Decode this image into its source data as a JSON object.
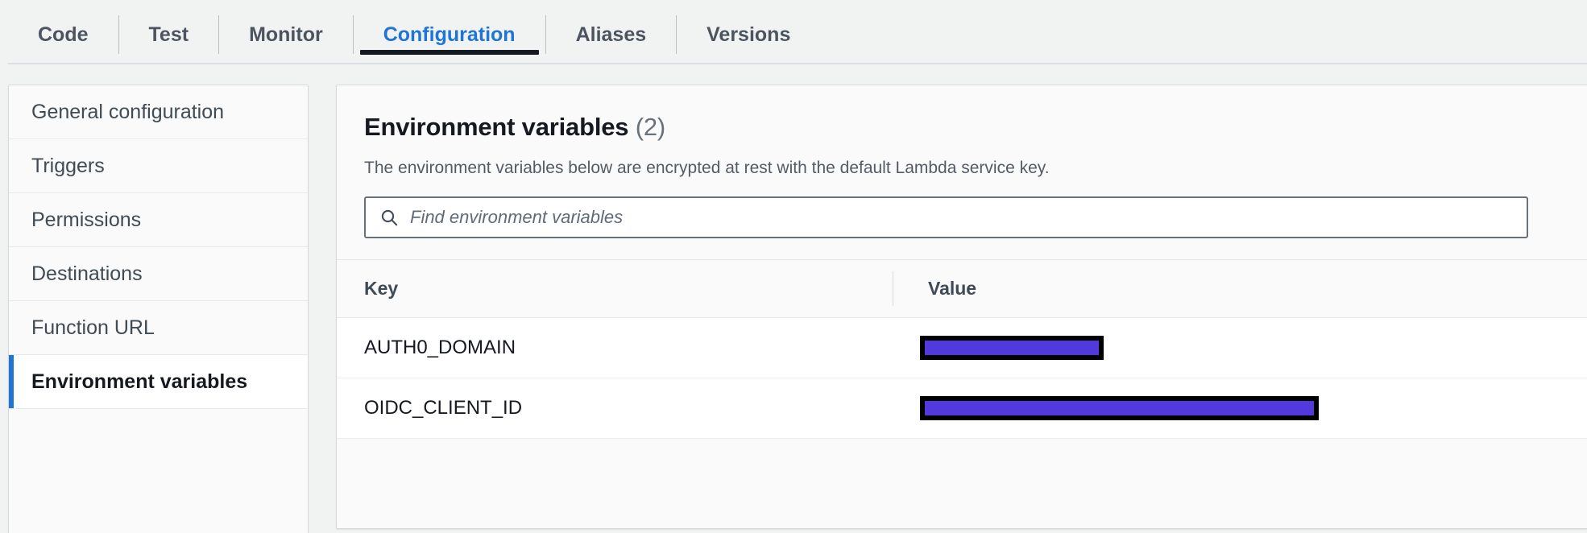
{
  "tabs": [
    {
      "label": "Code",
      "active": false
    },
    {
      "label": "Test",
      "active": false
    },
    {
      "label": "Monitor",
      "active": false
    },
    {
      "label": "Configuration",
      "active": true
    },
    {
      "label": "Aliases",
      "active": false
    },
    {
      "label": "Versions",
      "active": false
    }
  ],
  "sidebar": {
    "items": [
      {
        "label": "General configuration",
        "selected": false
      },
      {
        "label": "Triggers",
        "selected": false
      },
      {
        "label": "Permissions",
        "selected": false
      },
      {
        "label": "Destinations",
        "selected": false
      },
      {
        "label": "Function URL",
        "selected": false
      },
      {
        "label": "Environment variables",
        "selected": true
      }
    ]
  },
  "panel": {
    "title": "Environment variables",
    "count": "(2)",
    "description": "The environment variables below are encrypted at rest with the default Lambda service key.",
    "search": {
      "placeholder": "Find environment variables",
      "value": "",
      "icon": "search-icon"
    },
    "table": {
      "columns": [
        "Key",
        "Value"
      ],
      "rows": [
        {
          "key": "AUTH0_DOMAIN",
          "value": "",
          "value_redacted": true,
          "redaction_width": 228
        },
        {
          "key": "OIDC_CLIENT_ID",
          "value": "",
          "value_redacted": true,
          "redaction_width": 495
        }
      ]
    }
  },
  "colors": {
    "accent_blue": "#2074d5",
    "active_tab_underline": "#16191f",
    "redaction_fill": "#5139de",
    "redaction_border": "#000000",
    "page_background": "#f1f3f3",
    "panel_background": "#fafafa"
  }
}
